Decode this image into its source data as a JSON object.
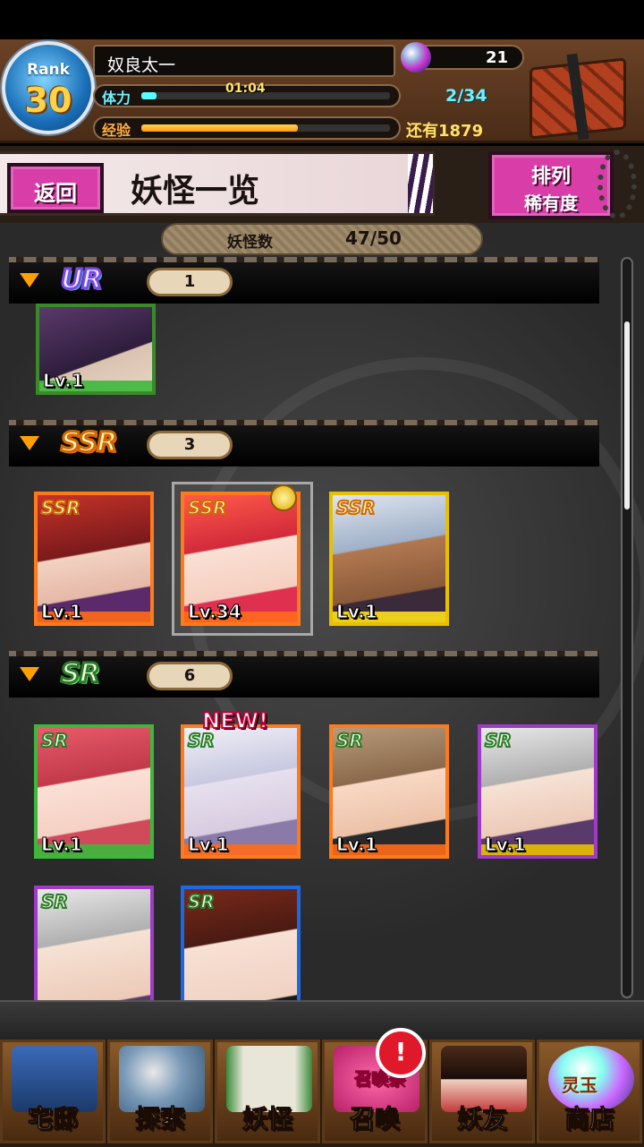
{
  "player": {
    "rank_label": "Rank",
    "rank": "30",
    "name": "奴良太一",
    "gems": "21",
    "stamina_label": "体力",
    "stamina_timer": "01:04",
    "stamina_count": "2/34",
    "stamina_fraction": 0.06,
    "exp_label": "经验",
    "exp_remaining": "还有1879",
    "exp_fraction": 0.62
  },
  "title_bar": {
    "back_label": "返回",
    "title": "妖怪一览",
    "sort_title": "排列",
    "sort_value": "稀有度"
  },
  "collection": {
    "count_label": "妖怪数",
    "count_value": "47/50"
  },
  "sections": [
    {
      "rarity": "UR",
      "count": "1"
    },
    {
      "rarity": "SSR",
      "count": "3"
    },
    {
      "rarity": "SR",
      "count": "6"
    }
  ],
  "cards": {
    "ur": [
      {
        "level": "Lv.1"
      }
    ],
    "ssr": [
      {
        "tag": "SSR",
        "level": "Lv.1"
      },
      {
        "tag": "SSR",
        "level": "Lv.34"
      },
      {
        "tag": "SSR",
        "level": "Lv.1"
      }
    ],
    "sr": [
      {
        "tag": "SR",
        "level": "Lv.1"
      },
      {
        "tag": "SR",
        "level": "Lv.1",
        "badge": "NEW!"
      },
      {
        "tag": "SR",
        "level": "Lv.1"
      },
      {
        "tag": "SR",
        "level": "Lv.1"
      },
      {
        "tag": "SR"
      },
      {
        "tag": "SR"
      }
    ]
  },
  "nav": {
    "items": [
      {
        "label": "宅邸",
        "icon": "mansion-icon"
      },
      {
        "label": "探索",
        "icon": "map-magnifier-icon"
      },
      {
        "label": "妖怪",
        "icon": "scroll-icon"
      },
      {
        "label": "召唤",
        "icon": "summon-star-icon",
        "badge": "召唤祭"
      },
      {
        "label": "妖友",
        "icon": "friend-icon"
      },
      {
        "label": "商店",
        "icon": "spirit-orb-icon",
        "badge": "灵玉"
      }
    ],
    "alert": "!"
  }
}
